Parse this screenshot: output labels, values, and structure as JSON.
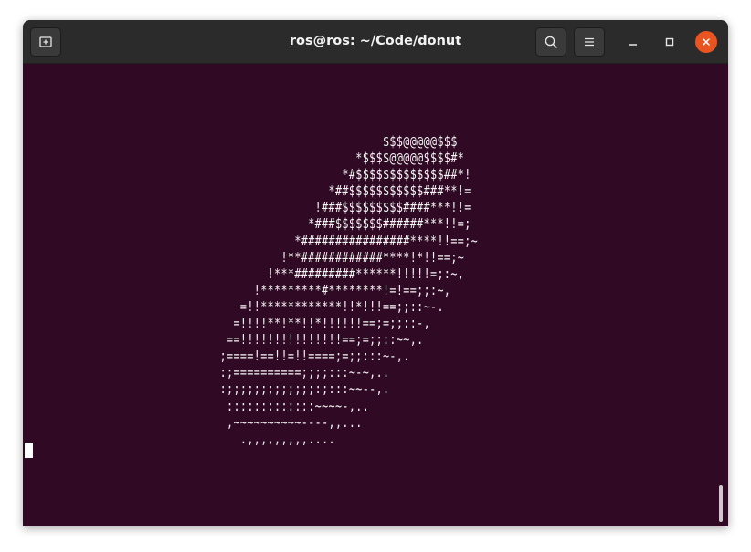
{
  "window": {
    "title": "ros@ros: ~/Code/donut"
  },
  "header": {
    "new_tab_icon": "new-tab-icon",
    "search_icon": "search-icon",
    "menu_icon": "hamburger-menu-icon",
    "minimize_icon": "minimize-icon",
    "maximize_icon": "maximize-icon",
    "close_icon": "close-icon"
  },
  "colors": {
    "terminal_bg": "#300a24",
    "titlebar_bg": "#2b2b2b",
    "close_accent": "#e95420",
    "text": "#f5f5f5"
  },
  "terminal": {
    "output_lines": [
      "                                                     $$$@@@@@$$$",
      "                                                 *$$$$@@@@@$$$$#*",
      "                                               *#$$$$$$$$$$$$$##*!",
      "                                             *##$$$$$$$$$$$###**!=",
      "                                           !###$$$$$$$$$####***!!=",
      "                                          *###$$$$$$$######***!!=;",
      "                                        *################****!!==;~",
      "                                      !**############****!*!!==;~",
      "                                    !***#########******!!!!!=;:~,",
      "                                  !*********#********!=!==;;:~,",
      "                                =!!************!!*!!!==;;::~-.",
      "                               =!!!!**!**!!*!!!!!!==;=;;::-,",
      "                              ==!!!!!!!!!!!!!!!==;=;;::~~,.",
      "                             ;====!==!!=!!====;=;;:::~-,.",
      "                             :;==========;;;;:::~-~,..",
      "                             :;;;;;;;;;;;;;:;:::~~--,.",
      "                              :::::::::::::~~~~-,..",
      "                              ,~~~~~~~~~~----,,...",
      "                                .,,,,,,,,,...."
    ]
  }
}
